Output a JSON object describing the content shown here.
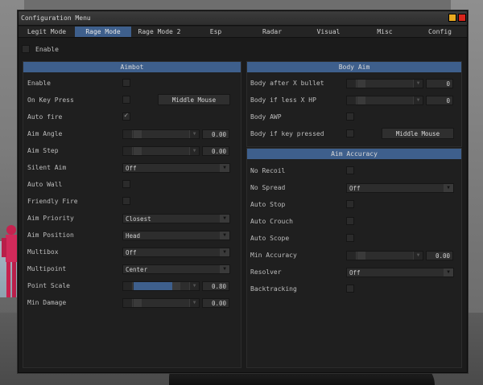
{
  "window": {
    "title": "Configuration Menu"
  },
  "tabs": [
    "Legit Mode",
    "Rage Mode",
    "Rage Mode 2",
    "Esp",
    "Radar",
    "Visual",
    "Misc",
    "Config"
  ],
  "active_tab": "Rage Mode",
  "global_enable": {
    "label": "Enable",
    "checked": false
  },
  "aimbot": {
    "header": "Aimbot",
    "enable": "Enable",
    "on_key_press": "On Key Press",
    "key_button": "Middle Mouse",
    "auto_fire": "Auto fire",
    "aim_angle": {
      "label": "Aim Angle",
      "value": "0.00"
    },
    "aim_step": {
      "label": "Aim Step",
      "value": "0.00"
    },
    "silent_aim": {
      "label": "Silent Aim",
      "value": "Off"
    },
    "auto_wall": "Auto Wall",
    "friendly_fire": "Friendly Fire",
    "aim_priority": {
      "label": "Aim Priority",
      "value": "Closest"
    },
    "aim_position": {
      "label": "Aim Position",
      "value": "Head"
    },
    "multibox": {
      "label": "Multibox",
      "value": "Off"
    },
    "multipoint": {
      "label": "Multipoint",
      "value": "Center"
    },
    "point_scale": {
      "label": "Point Scale",
      "value": "0.80",
      "fraction": 0.8
    },
    "min_damage": {
      "label": "Min Damage",
      "value": "0.00"
    }
  },
  "body_aim": {
    "header": "Body Aim",
    "after_x_bullet": {
      "label": "Body after X bullet",
      "value": "0"
    },
    "if_less_x_hp": {
      "label": "Body if less X HP",
      "value": "0"
    },
    "body_awp": "Body AWP",
    "if_key_pressed": "Body if key pressed",
    "key_button": "Middle Mouse"
  },
  "aim_accuracy": {
    "header": "Aim Accuracy",
    "no_recoil": "No Recoil",
    "no_spread": {
      "label": "No Spread",
      "value": "Off"
    },
    "auto_stop": "Auto Stop",
    "auto_crouch": "Auto Crouch",
    "auto_scope": "Auto Scope",
    "min_accuracy": {
      "label": "Min Accuracy",
      "value": "0.00"
    },
    "resolver": {
      "label": "Resolver",
      "value": "Off"
    },
    "backtracking": "Backtracking"
  },
  "colors": {
    "accent": "#3e5f8c",
    "minimize": "#e9a920",
    "close": "#d7241c",
    "panel": "#1f1f1f"
  }
}
